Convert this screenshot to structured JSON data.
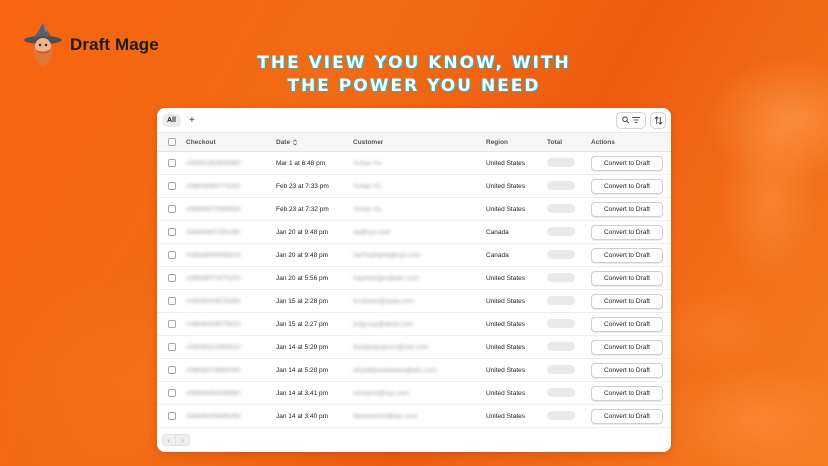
{
  "brand": {
    "name": "Draft Mage",
    "logo_icon": "wizard-logo-icon"
  },
  "headline": {
    "line1": "THE VIEW YOU KNOW, WITH",
    "line2": "THE POWER YOU NEED"
  },
  "toolbar": {
    "tab_all": "All",
    "add_view": "+",
    "search_filter_icon": "search-filter-icon",
    "sort_icon": "sort-arrows-icon"
  },
  "table": {
    "headers": {
      "checkout": "Checkout",
      "date": "Date",
      "customer": "Customer",
      "region": "Region",
      "total": "Total",
      "actions": "Actions"
    },
    "sort_icon": "sort-updown-icon",
    "rows": [
      {
        "checkout": "#38652263849380",
        "date": "Mar 1 at 6:48 pm",
        "customer": "Yuhao Xu",
        "region": "United States",
        "action": "Convert to Draft"
      },
      {
        "checkout": "#38648080774332",
        "date": "Feb 23 at 7:33 pm",
        "customer": "Yuhao Xu",
        "region": "United States",
        "action": "Convert to Draft"
      },
      {
        "checkout": "#38648072698558",
        "date": "Feb 23 at 7:32 pm",
        "customer": "Yuhao Xu",
        "region": "United States",
        "action": "Convert to Draft"
      },
      {
        "checkout": "#38648407391166",
        "date": "Jan 20 at 9:48 pm",
        "customer": "aa@xyz.com",
        "region": "Canada",
        "action": "Convert to Draft"
      },
      {
        "checkout": "#38648640696618",
        "date": "Jan 20 at 9:48 pm",
        "customer": "haiThaiNyHk@xyz.com",
        "region": "Canada",
        "action": "Convert to Draft"
      },
      {
        "checkout": "#38648072675200",
        "date": "Jan 20 at 5:56 pm",
        "customer": "hopehonger@abc.com",
        "region": "United States",
        "action": "Convert to Draft"
      },
      {
        "checkout": "#38648409076384",
        "date": "Jan 15 at 2:28 pm",
        "customer": "kcsbeam@aaaa.com",
        "region": "United States",
        "action": "Convert to Draft"
      },
      {
        "checkout": "#38648409078633",
        "date": "Jan 15 at 2:27 pm",
        "customer": "eclgroup@abcd.com",
        "region": "United States",
        "action": "Convert to Draft"
      },
      {
        "checkout": "#38648322888810",
        "date": "Jan 14 at 5:29 pm",
        "customer": "thedavepaysun@nas.com",
        "region": "United States",
        "action": "Convert to Draft"
      },
      {
        "checkout": "#38648378892040",
        "date": "Jan 14 at 5:28 pm",
        "customer": "whydidyoudoeeee@abc.com",
        "region": "United States",
        "action": "Convert to Draft"
      },
      {
        "checkout": "#38648353289880",
        "date": "Jan 14 at 3:41 pm",
        "customer": "tomfarrel@xyz.com",
        "region": "United States",
        "action": "Convert to Draft"
      },
      {
        "checkout": "#38648150895059",
        "date": "Jan 14 at 3:40 pm",
        "customer": "banananine@xyz.com",
        "region": "United States",
        "action": "Convert to Draft"
      }
    ]
  },
  "pagination": {
    "prev": "‹",
    "next": "›"
  },
  "colors": {
    "background": "#f26b14",
    "headline_shadow": "#1fb6c8",
    "card": "#ffffff"
  }
}
